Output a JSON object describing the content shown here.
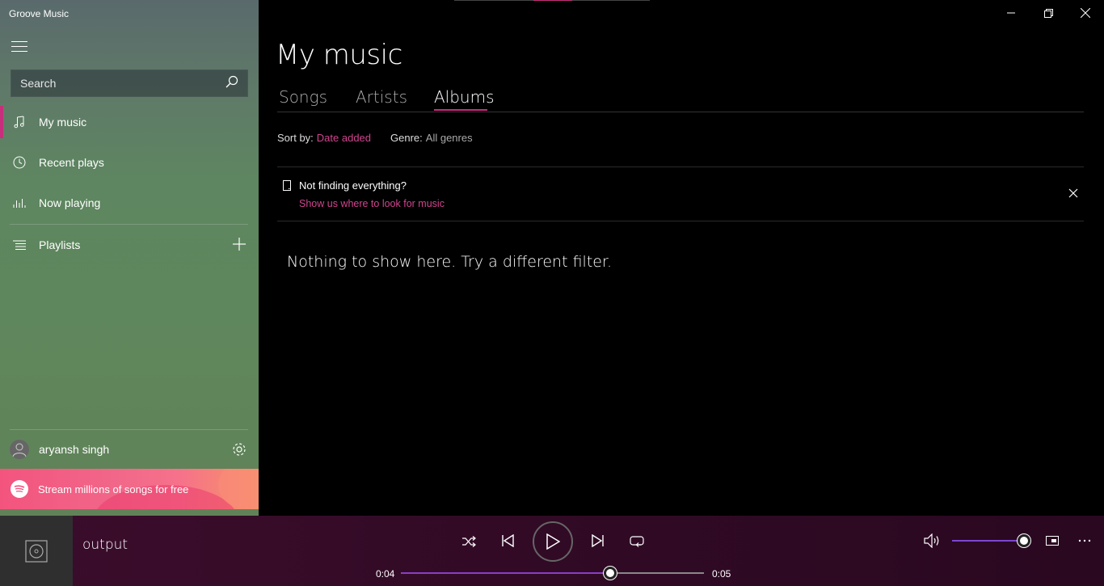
{
  "app": {
    "title": "Groove Music"
  },
  "colors": {
    "accent": "#c72e7b",
    "accent_text": "#d0448e",
    "seek_fill": "#8a3ec6",
    "volume_fill": "#7b46d0"
  },
  "sidebar": {
    "search": {
      "placeholder": "Search"
    },
    "items": [
      {
        "label": "My music",
        "icon": "music-note-icon",
        "active": true
      },
      {
        "label": "Recent plays",
        "icon": "clock-icon",
        "active": false
      },
      {
        "label": "Now playing",
        "icon": "equalizer-icon",
        "active": false
      },
      {
        "label": "Playlists",
        "icon": "playlist-icon",
        "active": false
      }
    ],
    "user": {
      "name": "aryansh singh"
    },
    "promo": {
      "label": "Stream millions of songs for free"
    }
  },
  "main": {
    "title": "My music",
    "tabs": [
      {
        "label": "Songs",
        "active": false
      },
      {
        "label": "Artists",
        "active": false
      },
      {
        "label": "Albums",
        "active": true
      }
    ],
    "sort": {
      "label": "Sort by:",
      "value": "Date added"
    },
    "genre": {
      "label": "Genre:",
      "value": "All genres"
    },
    "notice": {
      "title": "Not finding everything?",
      "link": "Show us where to look for music"
    },
    "empty_message": "Nothing to show here. Try a different filter."
  },
  "player": {
    "track": "output",
    "elapsed": "0:04",
    "total": "0:05",
    "progress_fraction": 0.69,
    "volume_fraction": 1.0
  }
}
